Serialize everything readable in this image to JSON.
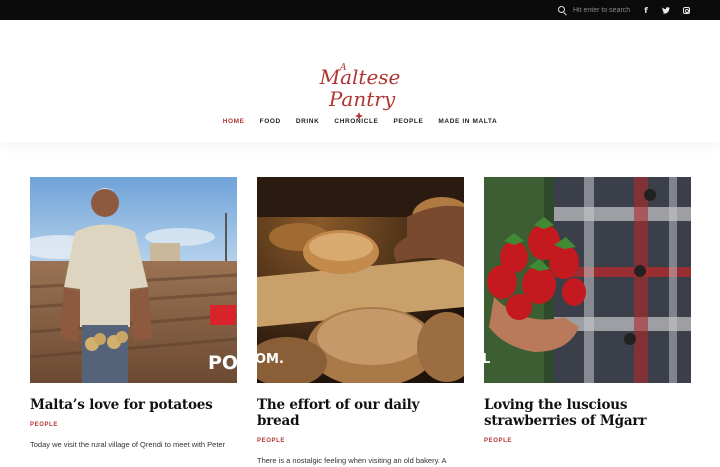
{
  "topbar": {
    "search_placeholder": "Hit enter to search",
    "social": [
      {
        "icon": "facebook-icon",
        "glyph": "f"
      },
      {
        "icon": "twitter-icon",
        "glyph": "t"
      },
      {
        "icon": "instagram-icon",
        "glyph": ""
      }
    ]
  },
  "brand": {
    "logo_line1": "Maltese",
    "logo_line2": "Pantry",
    "logo_a": "A",
    "color": "#b03532"
  },
  "nav": {
    "items": [
      {
        "label": "HOME",
        "active": true
      },
      {
        "label": "FOOD",
        "active": false
      },
      {
        "label": "DRINK",
        "active": false
      },
      {
        "label": "CHRONICLE",
        "active": false
      },
      {
        "label": "PEOPLE",
        "active": false
      },
      {
        "label": "MADE IN MALTA",
        "active": false
      }
    ]
  },
  "articles": [
    {
      "title": "Malta’s love for potatoes",
      "category": "PEOPLE",
      "excerpt": "Today we visit the rural village of Qrendi to meet with Peter",
      "watermark": "PO"
    },
    {
      "title": "The effort of our daily bread",
      "category": "PEOPLE",
      "excerpt": "There is a nostalgic feeling when visiting an old bakery. A",
      "watermark": "OM."
    },
    {
      "title": "Loving the luscious strawberries of Mġarr",
      "category": "PEOPLE",
      "excerpt": "",
      "watermark": "L"
    }
  ]
}
